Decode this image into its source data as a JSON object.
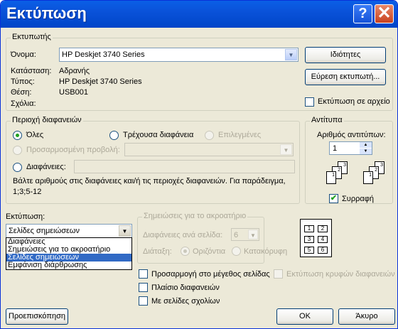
{
  "window": {
    "title": "Εκτύπωση",
    "help_glyph": "?",
    "close_glyph": "✕"
  },
  "printer": {
    "legend": "Εκτυπωτής",
    "name_label": "Όνομα:",
    "name_value": "HP Deskjet 3740 Series",
    "status_label": "Κατάσταση:",
    "status_value": "Αδρανής",
    "type_label": "Τύπος:",
    "type_value": "HP Deskjet 3740 Series",
    "where_label": "Θέση:",
    "where_value": "USB001",
    "comment_label": "Σχόλια:",
    "properties_button": "Ιδιότητες",
    "find_button": "Εύρεση εκτυπωτή...",
    "print_to_file": "Εκτύπωση σε αρχείο"
  },
  "range": {
    "legend": "Περιοχή διαφανειών",
    "all": "Όλες",
    "current": "Τρέχουσα διαφάνεια",
    "selection": "Επιλεγμένες",
    "custom_show": "Προσαρμοσμένη προβολή:",
    "slides": "Διαφάνειες:",
    "hint": "Βάλτε αριθμούς στις διαφάνειες και/ή τις περιοχές διαφανειών. Για παράδειγμα,",
    "hint_example": "1;3;5-12"
  },
  "copies": {
    "legend": "Αντίτυπα",
    "count_label": "Αριθμός αντιτύπων:",
    "count_value": "1",
    "collate": "Συρραφή"
  },
  "print_what": {
    "label": "Εκτύπωση:",
    "selected": "Σελίδες σημειώσεων",
    "options": [
      "Διαφάνειες",
      "Σημειώσεις για το ακροατήριο",
      "Σελίδες σημειώσεων",
      "Εμφάνιση διάρθρωσης"
    ],
    "selected_index": 2
  },
  "handouts": {
    "legend": "Σημειώσεις για το ακροατήριο",
    "per_page_label": "Διαφάνειες ανά σελίδα:",
    "per_page_value": "6",
    "order_label": "Διάταξη:",
    "horizontal": "Οριζόντια",
    "vertical": "Κατακόρυφη",
    "preview_numbers": [
      "1",
      "2",
      "3",
      "4",
      "5",
      "6"
    ]
  },
  "options": {
    "scale_to_fit": "Προσαρμογή στο μέγεθος σελίδας",
    "print_hidden": "Εκτύπωση κρυφών διαφανειών",
    "frame_slides": "Πλαίσιο διαφανειών",
    "include_comments": "Με σελίδες σχολίων"
  },
  "footer": {
    "preview": "Προεπισκόπηση",
    "ok": "ΟΚ",
    "cancel": "Άκυρο"
  },
  "collate_icons": {
    "stack1": [
      "1",
      "2",
      "3"
    ],
    "stack2": [
      "1",
      "2",
      "3"
    ]
  }
}
